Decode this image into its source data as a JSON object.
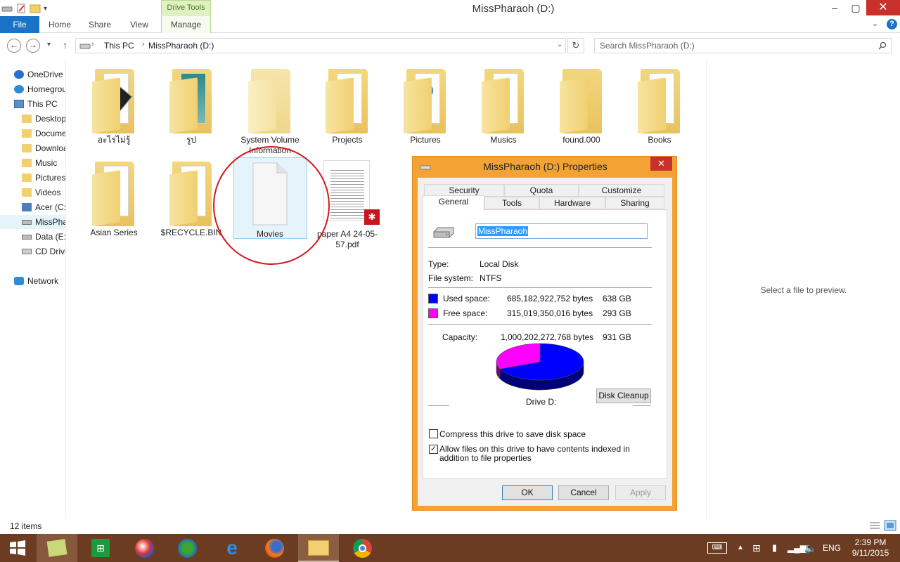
{
  "window": {
    "title": "MissPharaoh (D:)",
    "contextual_group": "Drive Tools",
    "controls": {
      "minimize": "–",
      "restore": "▢",
      "close": "✕"
    }
  },
  "ribbon": {
    "tabs": [
      "File",
      "Home",
      "Share",
      "View",
      "Manage"
    ]
  },
  "address": {
    "path": [
      "This PC",
      "MissPharaoh (D:)"
    ],
    "search_placeholder": "Search MissPharaoh (D:)"
  },
  "nav": {
    "items": [
      {
        "label": "OneDrive",
        "icon": "cloud-icon"
      },
      {
        "label": "Homegroup",
        "icon": "homegroup-icon"
      },
      {
        "label": "This PC",
        "icon": "computer-icon"
      },
      {
        "label": "Desktop",
        "icon": "folder-icon"
      },
      {
        "label": "Documents",
        "icon": "folder-icon"
      },
      {
        "label": "Downloads",
        "icon": "folder-icon"
      },
      {
        "label": "Music",
        "icon": "folder-icon"
      },
      {
        "label": "Pictures",
        "icon": "folder-icon"
      },
      {
        "label": "Videos",
        "icon": "folder-icon"
      },
      {
        "label": "Acer (C:)",
        "icon": "drive-icon"
      },
      {
        "label": "MissPharaoh (D:)",
        "icon": "drive-icon"
      },
      {
        "label": "Data (E:)",
        "icon": "drive-icon"
      },
      {
        "label": "CD Drive",
        "icon": "cd-drive-icon"
      },
      {
        "label": "Network",
        "icon": "network-icon"
      }
    ]
  },
  "files": [
    {
      "label": "อะไรไม่รู้",
      "type": "folder"
    },
    {
      "label": "รูป",
      "type": "folder"
    },
    {
      "label": "System Volume Information",
      "type": "folder"
    },
    {
      "label": "Projects",
      "type": "folder"
    },
    {
      "label": "Pictures",
      "type": "folder"
    },
    {
      "label": "Musics",
      "type": "folder"
    },
    {
      "label": "found.000",
      "type": "folder"
    },
    {
      "label": "Books",
      "type": "folder"
    },
    {
      "label": "Asian Series",
      "type": "folder"
    },
    {
      "label": "$RECYCLE.BIN",
      "type": "folder"
    },
    {
      "label": "Movies",
      "type": "file"
    },
    {
      "label": "paper A4 24-05-57.pdf",
      "type": "pdf"
    }
  ],
  "preview": {
    "message": "Select a file to preview."
  },
  "status": {
    "item_count": "12 items"
  },
  "dialog": {
    "title": "MissPharaoh (D:) Properties",
    "tabs_row1": [
      "Security",
      "Quota",
      "Customize"
    ],
    "tabs_row2": [
      "General",
      "Tools",
      "Hardware",
      "Sharing"
    ],
    "active_tab": "General",
    "drive_name": "MissPharaoh",
    "type_label": "Type:",
    "type_value": "Local Disk",
    "fs_label": "File system:",
    "fs_value": "NTFS",
    "used_label": "Used space:",
    "used_bytes": "685,182,922,752 bytes",
    "used_gb": "638 GB",
    "free_label": "Free space:",
    "free_bytes": "315,019,350,016 bytes",
    "free_gb": "293 GB",
    "capacity_label": "Capacity:",
    "capacity_bytes": "1,000,202,272,768 bytes",
    "capacity_gb": "931 GB",
    "drive_caption": "Drive D:",
    "disk_cleanup": "Disk Cleanup",
    "compress_label": "Compress this drive to save disk space",
    "compress_checked": false,
    "index_label": "Allow files on this drive to have contents indexed in addition to file properties",
    "index_checked": true,
    "ok": "OK",
    "cancel": "Cancel",
    "apply": "Apply",
    "used_color": "#0000ff",
    "free_color": "#ff00ff",
    "used_fraction": 0.685
  },
  "taskbar": {
    "tray_lang": "ENG",
    "time": "2:39 PM",
    "date": "9/11/2015"
  },
  "colors": {
    "dialog_frame": "#f4a233",
    "taskbar": "#6b3c22",
    "accent": "#1a73c7"
  }
}
